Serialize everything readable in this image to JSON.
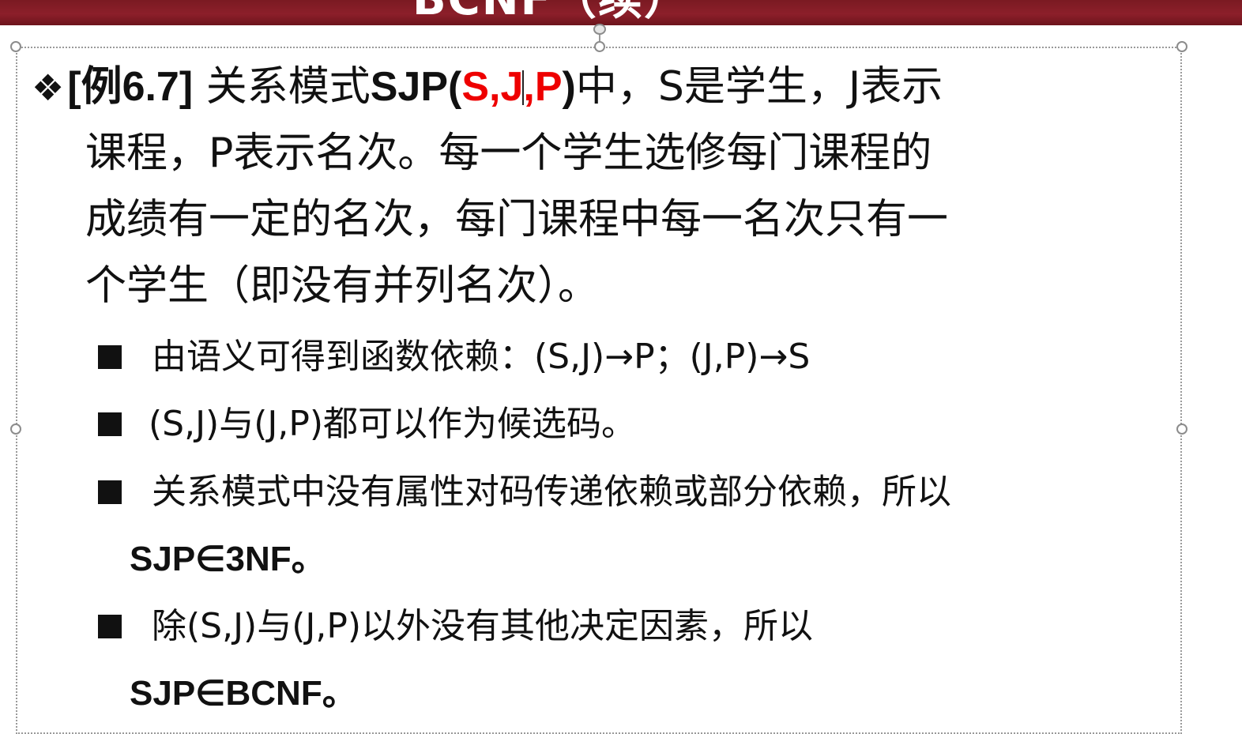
{
  "slide": {
    "title": "BCNF（续）",
    "bullet_symbol": "❖",
    "example": {
      "tag": "[例6.7]",
      "intro": "关系模式",
      "relation_name": "SJP",
      "paren_open": "(",
      "attr_s": "S",
      "comma1": ",",
      "attr_j": "J",
      "comma2": ",",
      "attr_p": "P",
      "paren_close": ")",
      "line1_rest": "中，S是学生，J表示",
      "line2": "课程，P表示名次。每一个学生选修每门课程的",
      "line3": "成绩有一定的名次，每门课程中每一名次只有一",
      "line4": "个学生（即没有并列名次）。"
    },
    "points": [
      {
        "line1": "由语义可得到函数依赖：(S,J)→P；(J,P)→S"
      },
      {
        "line1": "(S,J)与(J,P)都可以作为候选码。"
      },
      {
        "line1": "关系模式中没有属性对码传递依赖或部分依赖，所以",
        "line2": "SJP∈3NF。"
      },
      {
        "line1": "除(S,J)与(J,P)以外没有其他决定因素，所以",
        "line2": "SJP∈BCNF。"
      }
    ]
  },
  "colors": {
    "title_bar": "#8c1f2a",
    "highlight": "#ee0000",
    "text": "#111111"
  }
}
